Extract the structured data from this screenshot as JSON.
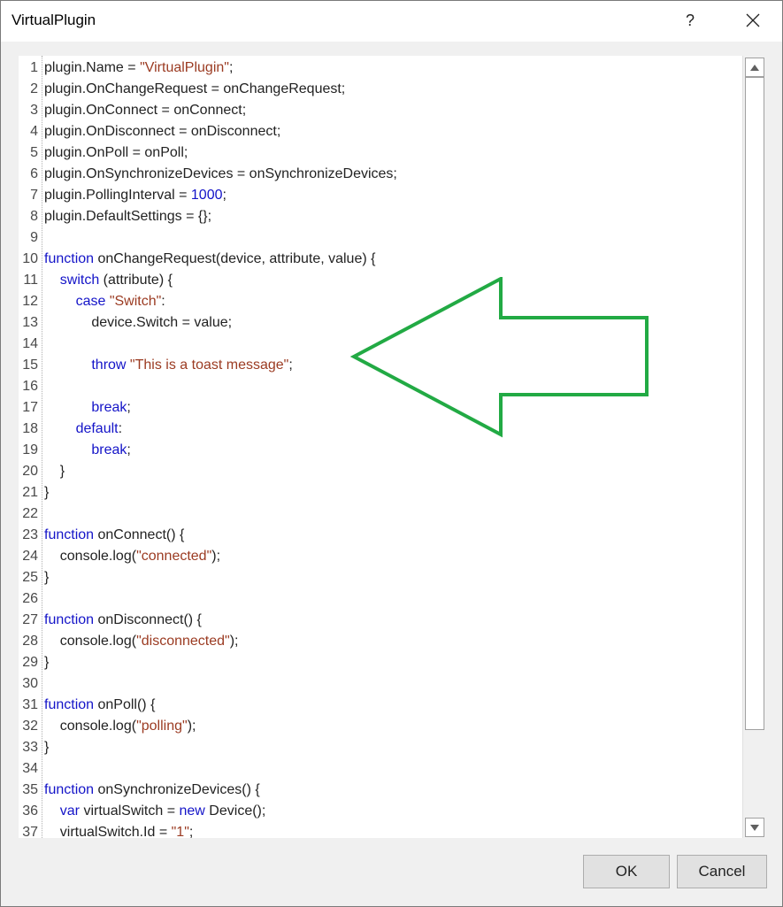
{
  "window": {
    "title": "VirtualPlugin",
    "help_label": "?",
    "close_icon": "close-icon"
  },
  "code_lines": [
    [
      [
        "",
        "plugin.Name = "
      ],
      [
        "str",
        "\"VirtualPlugin\""
      ],
      [
        "",
        ";"
      ]
    ],
    [
      [
        "",
        "plugin.OnChangeRequest = onChangeRequest;"
      ]
    ],
    [
      [
        "",
        "plugin.OnConnect = onConnect;"
      ]
    ],
    [
      [
        "",
        "plugin.OnDisconnect = onDisconnect;"
      ]
    ],
    [
      [
        "",
        "plugin.OnPoll = onPoll;"
      ]
    ],
    [
      [
        "",
        "plugin.OnSynchronizeDevices = onSynchronizeDevices;"
      ]
    ],
    [
      [
        "",
        "plugin.PollingInterval = "
      ],
      [
        "num",
        "1000"
      ],
      [
        "",
        ";"
      ]
    ],
    [
      [
        "",
        "plugin.DefaultSettings = {};"
      ]
    ],
    [],
    [
      [
        "kw",
        "function"
      ],
      [
        "",
        " onChangeRequest(device, attribute, value) {"
      ]
    ],
    [
      [
        "",
        "    "
      ],
      [
        "kw",
        "switch"
      ],
      [
        "",
        " (attribute) {"
      ]
    ],
    [
      [
        "",
        "        "
      ],
      [
        "kw",
        "case"
      ],
      [
        "",
        " "
      ],
      [
        "str",
        "\"Switch\""
      ],
      [
        "",
        ":"
      ]
    ],
    [
      [
        "",
        "            device.Switch = value;"
      ]
    ],
    [],
    [
      [
        "",
        "            "
      ],
      [
        "kw",
        "throw"
      ],
      [
        "",
        " "
      ],
      [
        "str",
        "\"This is a toast message\""
      ],
      [
        "",
        ";"
      ]
    ],
    [],
    [
      [
        "",
        "            "
      ],
      [
        "kw",
        "break"
      ],
      [
        "",
        ";"
      ]
    ],
    [
      [
        "",
        "        "
      ],
      [
        "kw",
        "default"
      ],
      [
        "",
        ":"
      ]
    ],
    [
      [
        "",
        "            "
      ],
      [
        "kw",
        "break"
      ],
      [
        "",
        ";"
      ]
    ],
    [
      [
        "",
        "    }"
      ]
    ],
    [
      [
        "",
        "}"
      ]
    ],
    [],
    [
      [
        "kw",
        "function"
      ],
      [
        "",
        " onConnect() {"
      ]
    ],
    [
      [
        "",
        "    console.log("
      ],
      [
        "str",
        "\"connected\""
      ],
      [
        "",
        ");"
      ]
    ],
    [
      [
        "",
        "}"
      ]
    ],
    [],
    [
      [
        "kw",
        "function"
      ],
      [
        "",
        " onDisconnect() {"
      ]
    ],
    [
      [
        "",
        "    console.log("
      ],
      [
        "str",
        "\"disconnected\""
      ],
      [
        "",
        ");"
      ]
    ],
    [
      [
        "",
        "}"
      ]
    ],
    [],
    [
      [
        "kw",
        "function"
      ],
      [
        "",
        " onPoll() {"
      ]
    ],
    [
      [
        "",
        "    console.log("
      ],
      [
        "str",
        "\"polling\""
      ],
      [
        "",
        ");"
      ]
    ],
    [
      [
        "",
        "}"
      ]
    ],
    [],
    [
      [
        "kw",
        "function"
      ],
      [
        "",
        " onSynchronizeDevices() {"
      ]
    ],
    [
      [
        "",
        "    "
      ],
      [
        "kw",
        "var"
      ],
      [
        "",
        " virtualSwitch = "
      ],
      [
        "kw",
        "new"
      ],
      [
        "",
        " Device();"
      ]
    ],
    [
      [
        "",
        "    virtualSwitch.Id = "
      ],
      [
        "str",
        "\"1\""
      ],
      [
        "",
        ";"
      ]
    ]
  ],
  "annotation": {
    "arrow_icon": "arrow-left-icon",
    "color": "#22aa44"
  },
  "scrollbar": {
    "up_icon": "scroll-up-icon",
    "down_icon": "scroll-down-icon"
  },
  "buttons": {
    "ok_label": "OK",
    "cancel_label": "Cancel"
  },
  "colors": {
    "keyword": "#1414c8",
    "string": "#9b3b22",
    "text": "#222222"
  }
}
